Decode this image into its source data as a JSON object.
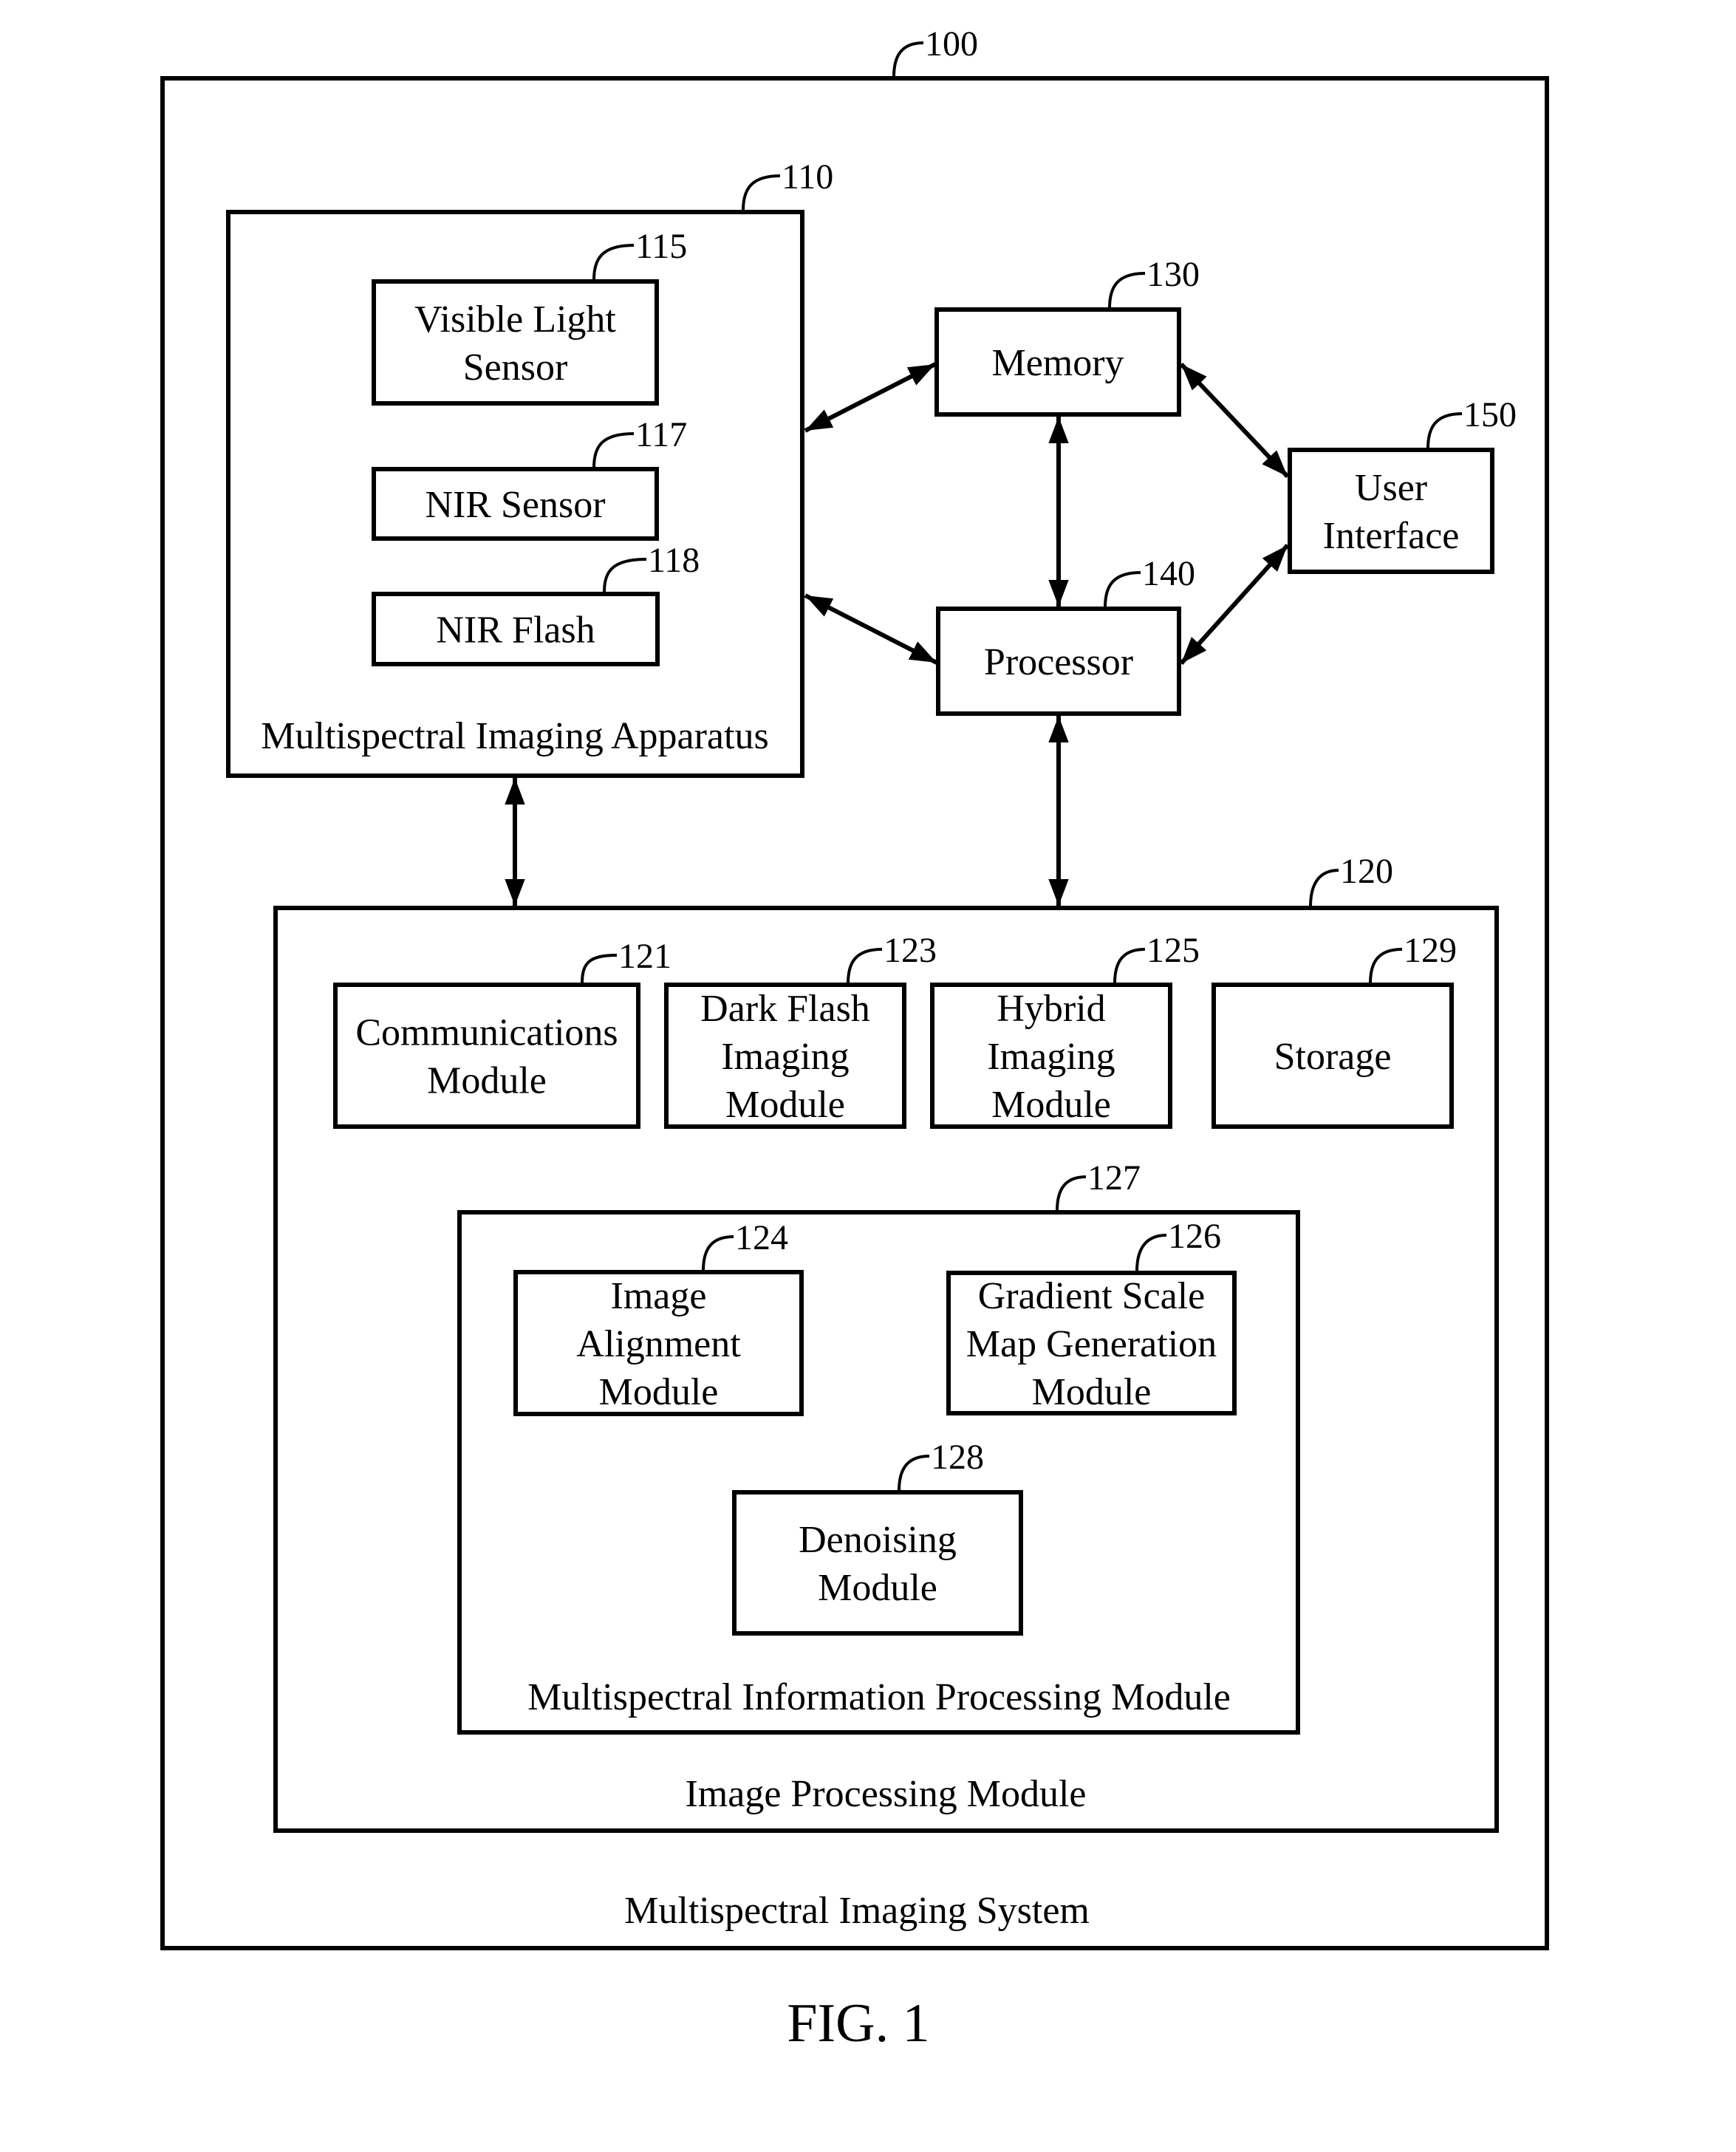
{
  "figure": {
    "caption": "FIG. 1",
    "system": {
      "ref": "100",
      "label": "Multispectral Imaging System"
    },
    "apparatus": {
      "ref": "110",
      "label": "Multispectral Imaging Apparatus"
    },
    "visible_light_sensor": {
      "ref": "115",
      "lines": [
        "Visible Light",
        "Sensor"
      ]
    },
    "nir_sensor": {
      "ref": "117",
      "lines": [
        "NIR Sensor"
      ]
    },
    "nir_flash": {
      "ref": "118",
      "lines": [
        "NIR Flash"
      ]
    },
    "memory": {
      "ref": "130",
      "lines": [
        "Memory"
      ]
    },
    "processor": {
      "ref": "140",
      "lines": [
        "Processor"
      ]
    },
    "user_interface": {
      "ref": "150",
      "lines": [
        "User",
        "Interface"
      ]
    },
    "image_processing": {
      "ref": "120",
      "label": "Image Processing Module"
    },
    "communications": {
      "ref": "121",
      "lines": [
        "Communications",
        "Module"
      ]
    },
    "dark_flash": {
      "ref": "123",
      "lines": [
        "Dark Flash",
        "Imaging",
        "Module"
      ]
    },
    "hybrid": {
      "ref": "125",
      "lines": [
        "Hybrid",
        "Imaging",
        "Module"
      ]
    },
    "storage": {
      "ref": "129",
      "lines": [
        "Storage"
      ]
    },
    "info_processing": {
      "ref": "127",
      "label": "Multispectral Information Processing Module"
    },
    "image_alignment": {
      "ref": "124",
      "lines": [
        "Image",
        "Alignment",
        "Module"
      ]
    },
    "gradient_scale": {
      "ref": "126",
      "lines": [
        "Gradient Scale",
        "Map Generation",
        "Module"
      ]
    },
    "denoising": {
      "ref": "128",
      "lines": [
        "Denoising",
        "Module"
      ]
    }
  },
  "connections": [
    {
      "from": "apparatus",
      "to": "memory",
      "type": "bidirectional"
    },
    {
      "from": "apparatus",
      "to": "processor",
      "type": "bidirectional"
    },
    {
      "from": "memory",
      "to": "processor",
      "type": "bidirectional"
    },
    {
      "from": "memory",
      "to": "user_interface",
      "type": "bidirectional"
    },
    {
      "from": "processor",
      "to": "user_interface",
      "type": "bidirectional"
    },
    {
      "from": "apparatus",
      "to": "image_processing",
      "type": "bidirectional"
    },
    {
      "from": "processor",
      "to": "image_processing",
      "type": "bidirectional"
    }
  ]
}
